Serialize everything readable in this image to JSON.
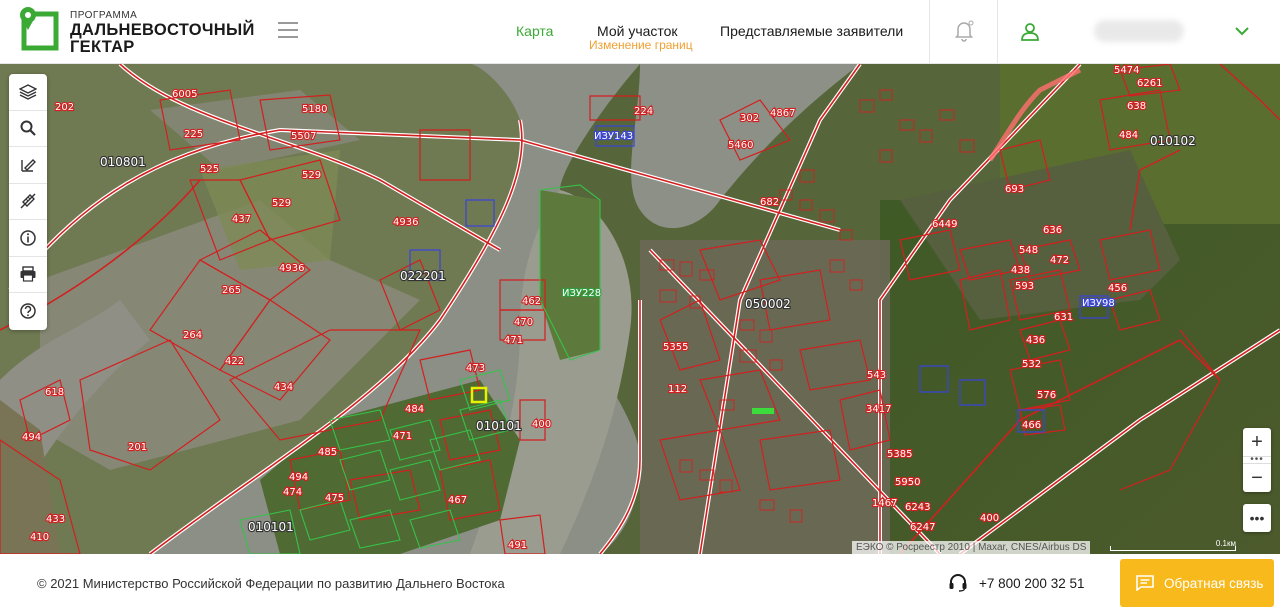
{
  "header": {
    "logo_small": "ПРОГРАММА",
    "logo_line1": "ДАЛЬНЕВОСТОЧНЫЙ",
    "logo_line2": "ГЕКТАР",
    "nav": {
      "map": "Карта",
      "my_plot": "Мой участок",
      "my_plot_sub": "Изменение границ",
      "applicants": "Представляемые заявители"
    }
  },
  "colors": {
    "brand_green": "#3aaa35",
    "accent_orange": "#f0a030",
    "feedback_yellow": "#f7b91b",
    "parcel_red": "#d31f1f"
  },
  "toolbar": {
    "tools": [
      "layers-icon",
      "search-icon",
      "edit-icon",
      "measure-icon",
      "info-icon",
      "print-icon",
      "help-icon"
    ]
  },
  "map": {
    "quarter_labels": [
      "010801",
      "050002",
      "010102",
      "010101",
      "010101",
      "022201"
    ],
    "zone_labels": [
      "ИЗУ143",
      "ИЗУ228",
      "ИЗУ98"
    ],
    "parcel_labels": [
      "202",
      "6005",
      "5180",
      "225",
      "5507",
      "525",
      "529",
      "529",
      "437",
      "4936",
      "4936",
      "265",
      "264",
      "422",
      "434",
      "201",
      "618",
      "494",
      "410",
      "433",
      "224",
      "302",
      "4867",
      "5460",
      "682",
      "462",
      "470",
      "471",
      "473",
      "484",
      "471",
      "485",
      "494",
      "474",
      "475",
      "467",
      "491",
      "400",
      "112",
      "5355",
      "6449",
      "636",
      "472",
      "438",
      "593",
      "548",
      "456",
      "631",
      "436",
      "532",
      "576",
      "466",
      "543",
      "3417",
      "5385",
      "5950",
      "1467",
      "6243",
      "6247",
      "400",
      "484",
      "638",
      "6261",
      "5474",
      "693"
    ],
    "attribution": "ЕЭКО © Росреестр 2010 | Maxar, CNES/Airbus DS",
    "scale_label": "0.1км",
    "zoom_in": "+",
    "zoom_out": "−"
  },
  "footer": {
    "copyright": "© 2021 Министерство Российской Федерации по развитию Дальнего Востока",
    "phone": "+7 800 200 32 51",
    "feedback": "Обратная связь"
  }
}
